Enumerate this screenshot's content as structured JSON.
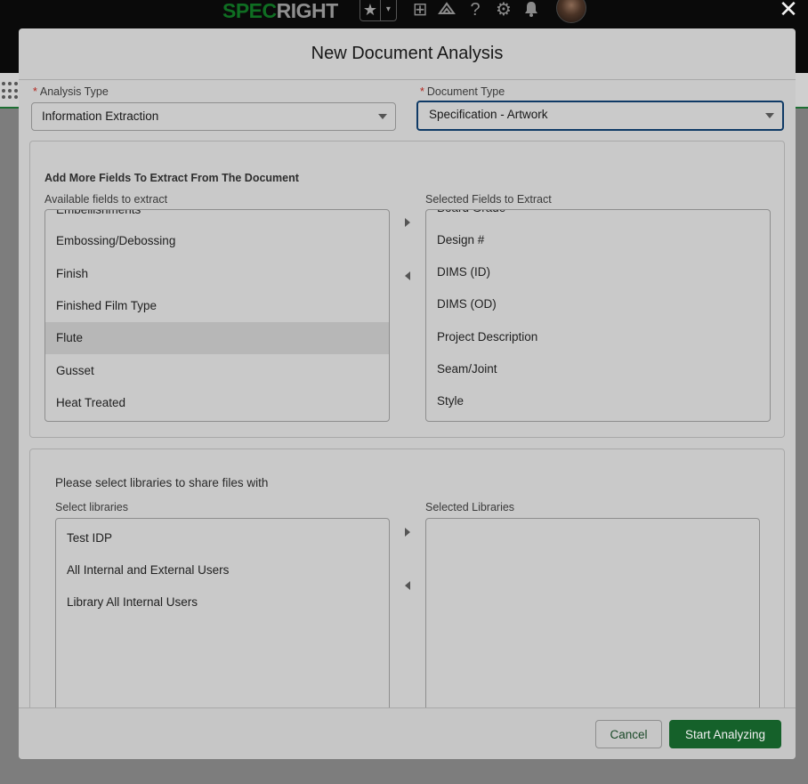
{
  "app": {
    "logo_green": "SPEC",
    "logo_grey": "RIGHT",
    "header_icons": [
      "star-icon",
      "chevron-down-icon",
      "add-icon",
      "trailhead-icon",
      "help-icon",
      "gear-icon",
      "bell-icon"
    ],
    "favorites_glyph": "★",
    "favorites_caret_glyph": "▾",
    "add_glyph": "⊞",
    "help_glyph": "?",
    "gear_glyph": "⚙",
    "bell_glyph": "🔔",
    "close_glyph": "✕"
  },
  "modal": {
    "title": "New Document Analysis",
    "analysis_type": {
      "label": "Analysis Type",
      "value": "Information Extraction"
    },
    "document_type": {
      "label": "Document Type",
      "value": "Specification - Artwork"
    },
    "fields_panel": {
      "heading": "Add More Fields To Extract From The Document",
      "available_label": "Available fields to extract",
      "selected_label": "Selected Fields to Extract",
      "available_options": [
        "Embellishments",
        "Embossing/Debossing",
        "Finish",
        "Finished Film Type",
        "Flute",
        "Gusset",
        "Heat Treated"
      ],
      "selected_available_option": "Flute",
      "selected_options": [
        "Board Grade",
        "Design #",
        "DIMS (ID)",
        "DIMS (OD)",
        "Project Description",
        "Seam/Joint",
        "Style"
      ]
    },
    "libraries_panel": {
      "prompt": "Please select libraries to share files with",
      "available_label": "Select libraries",
      "selected_label": "Selected Libraries",
      "available_options": [
        "Test IDP",
        "All Internal and External Users",
        "Library All Internal Users"
      ],
      "selected_options": []
    },
    "footer": {
      "cancel_label": "Cancel",
      "submit_label": "Start Analyzing"
    }
  },
  "colors": {
    "brand_green": "#15612a",
    "required_red": "#b3261e",
    "focus_blue": "#0f3a66"
  }
}
